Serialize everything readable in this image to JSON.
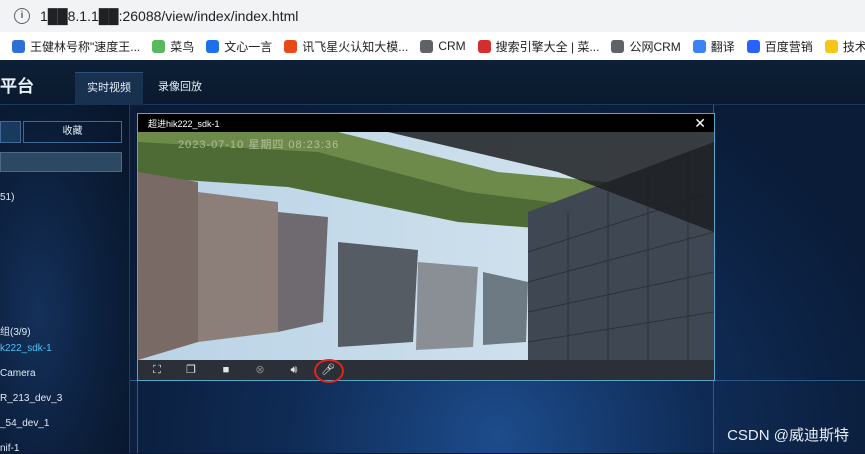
{
  "browser": {
    "url": "1██8.1.1██:26088/view/index/index.html",
    "bookmarks": [
      {
        "label": "王健林号称\"速度王...",
        "color": "#2f6fd6"
      },
      {
        "label": "菜鸟",
        "color": "#5cb85c"
      },
      {
        "label": "文心一言",
        "color": "#1f6feb"
      },
      {
        "label": "讯飞星火认知大模...",
        "color": "#e64a19"
      },
      {
        "label": "CRM",
        "color": "#5f6368"
      },
      {
        "label": "搜索引擎大全 | 菜...",
        "color": "#d32f2f"
      },
      {
        "label": "公网CRM",
        "color": "#5f6368"
      },
      {
        "label": "翻译",
        "color": "#3b82f6"
      },
      {
        "label": "百度营销",
        "color": "#2962ff"
      },
      {
        "label": "技术站",
        "color": "#f5c518"
      }
    ]
  },
  "app": {
    "title": "平台",
    "tabs": [
      "实时视频",
      "录像回放"
    ],
    "active_tab": "实时视频"
  },
  "sidebar": {
    "favorites_label": "收藏",
    "tree": [
      {
        "label": "51)",
        "selected": false
      },
      {
        "label": "组(3/9)",
        "selected": false
      },
      {
        "label": "k222_sdk-1",
        "selected": true
      },
      {
        "label": "Camera",
        "selected": false
      },
      {
        "label": "R_213_dev_3",
        "selected": false
      },
      {
        "label": "_54_dev_1",
        "selected": false
      },
      {
        "label": "nif-1",
        "selected": false
      }
    ]
  },
  "video": {
    "title": "超进hik222_sdk-1",
    "osd": "2023-07-10 星期四 08:23:36",
    "close_label": "✕"
  },
  "watermark": "CSDN @威迪斯特",
  "colors": {
    "accent": "#4fc3f7",
    "highlight_circle": "#e0251b",
    "window_border": "#5aa6c8"
  }
}
